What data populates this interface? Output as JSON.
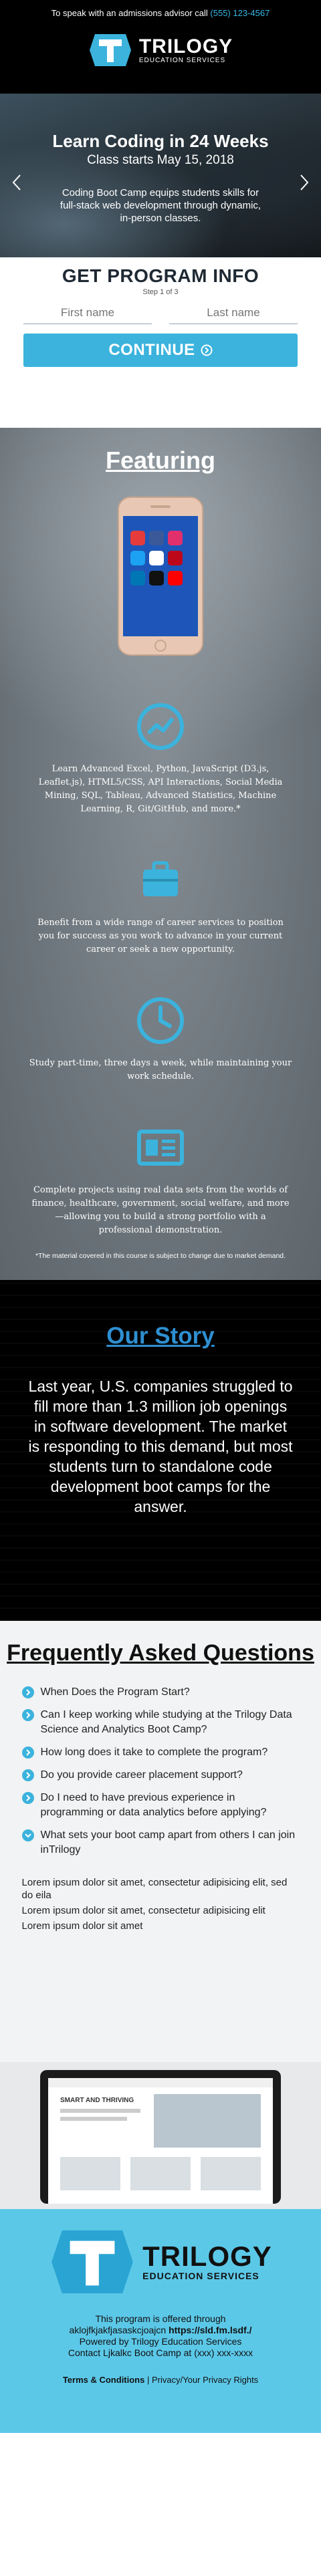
{
  "topbar": {
    "call_text": "To speak with an admissions advisor call",
    "phone": "(555) 123-4567"
  },
  "brand": {
    "name": "TRILOGY",
    "tagline": "EDUCATION SERVICES",
    "accent": "#3bb3dd",
    "logo_icon": "trilogy-t-logo"
  },
  "hero": {
    "title": "Learn Coding in 24 Weeks",
    "start": "Class starts May 15, 2018",
    "description": "Coding Boot Camp equips students skills for full-stack web development through dynamic, in-person classes."
  },
  "form": {
    "heading": "GET PROGRAM INFO",
    "step": "Step 1 of 3",
    "first_name_placeholder": "First name",
    "last_name_placeholder": "Last name",
    "first_name_value": "",
    "last_name_value": "",
    "cta": "CONTINUE"
  },
  "featuring": {
    "heading": "Featuring",
    "items": [
      {
        "icon": "chart-icon",
        "text": "Learn Advanced Excel, Python, JavaScript (D3.js, Leaflet.js), HTML5/CSS, API Interactions, Social Media Mining, SQL, Tableau, Advanced Statistics, Machine Learning, R, Git/GitHub, and more.*"
      },
      {
        "icon": "briefcase-icon",
        "text": "Benefit from a wide range of career services to position you for success as you work to advance in your current career or seek a new opportunity."
      },
      {
        "icon": "clock-icon",
        "text": "Study part-time, three days a week, while maintaining your work schedule."
      },
      {
        "icon": "portfolio-icon",
        "text": "Complete projects using real data sets from the worlds of finance, healthcare, government, social welfare, and more—allowing you to build a strong portfolio with a professional demonstration."
      }
    ],
    "disclaimer": "*The material covered in this course is subject to change due to market demand."
  },
  "story": {
    "heading": "Our Story",
    "text": "Last year, U.S. companies struggled to fill more than 1.3 million job openings in software development. The market is responding to this demand, but most students turn to standalone code development boot camps for the answer."
  },
  "faq": {
    "heading": "Frequently Asked Questions",
    "questions": [
      "When Does the Program Start?",
      "Can I keep working while studying at the Trilogy Data Science and Analytics Boot Camp?",
      "How long does it take to complete the program?",
      "Do you provide career placement support?",
      "Do I need to have previous experience in programming or data analytics before applying?",
      "What sets your boot camp apart from others I can join inTrilogy"
    ],
    "answers": [
      "Lorem ipsum dolor sit amet, consectetur adipisicing elit, sed do eila",
      "Lorem ipsum dolor sit amet, consectetur adipisicing elit",
      "Lorem ipsum dolor sit amet"
    ]
  },
  "laptop": {
    "screen_title": "SMART AND THRIVING"
  },
  "footer": {
    "line1": "This program is offered through",
    "line2_prefix": "aklojfkjakfjasaskcjoajcn",
    "line2_link": "https://sld.fm.lsdf./",
    "line3": "Powered by Trilogy Education Services",
    "line4": "Contact Ljkalkc Boot Camp at (xxx) xxx-xxxx",
    "terms": "Terms & Conditions",
    "separator": "|",
    "privacy": "Privacy/Your Privacy Rights"
  }
}
